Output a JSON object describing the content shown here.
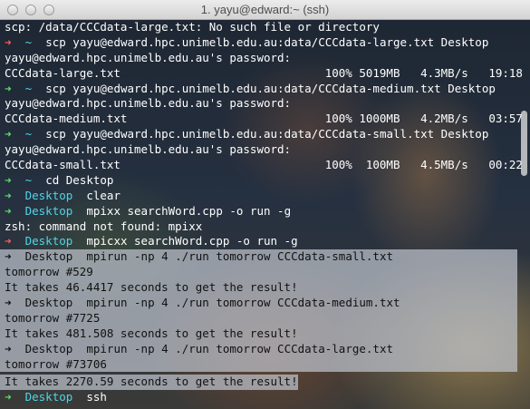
{
  "window": {
    "title": "1. yayu@edward:~ (ssh)"
  },
  "lines": [
    {
      "type": "text",
      "text": "scp: /data/CCCdata-large.txt: No such file or directory"
    },
    {
      "type": "cmd",
      "arrow": "red",
      "dir": "~",
      "cmd": "scp yayu@edward.hpc.unimelb.edu.au:data/CCCdata-large.txt Desktop"
    },
    {
      "type": "text",
      "text": "yayu@edward.hpc.unimelb.edu.au's password:"
    },
    {
      "type": "text",
      "text": "CCCdata-large.txt                              100% 5019MB   4.3MB/s   19:18"
    },
    {
      "type": "cmd",
      "arrow": "green",
      "dir": "~",
      "cmd": "scp yayu@edward.hpc.unimelb.edu.au:data/CCCdata-medium.txt Desktop"
    },
    {
      "type": "text",
      "text": "yayu@edward.hpc.unimelb.edu.au's password:"
    },
    {
      "type": "text",
      "text": "CCCdata-medium.txt                             100% 1000MB   4.2MB/s   03:57"
    },
    {
      "type": "cmd",
      "arrow": "green",
      "dir": "~",
      "cmd": "scp yayu@edward.hpc.unimelb.edu.au:data/CCCdata-small.txt Desktop"
    },
    {
      "type": "text",
      "text": "yayu@edward.hpc.unimelb.edu.au's password:"
    },
    {
      "type": "text",
      "text": "CCCdata-small.txt                              100%  100MB   4.5MB/s   00:22"
    },
    {
      "type": "cmd",
      "arrow": "green",
      "dir": "~",
      "cmd": "cd Desktop"
    },
    {
      "type": "cmd",
      "arrow": "green",
      "dir": "Desktop",
      "cmd": "clear"
    },
    {
      "type": "cmd",
      "arrow": "green",
      "dir": "Desktop",
      "cmd": "mpixx searchWord.cpp -o run -g"
    },
    {
      "type": "text",
      "text": "zsh: command not found: mpixx"
    },
    {
      "type": "cmd",
      "arrow": "red",
      "dir": "Desktop",
      "cmd": "mpicxx searchWord.cpp -o run -g"
    },
    {
      "type": "cmd",
      "arrow": "green",
      "dir": "Desktop",
      "cmd": "mpirun -np 4 ./run tomorrow CCCdata-small.txt",
      "selected": true
    },
    {
      "type": "text",
      "text": "tomorrow #529",
      "selected": true
    },
    {
      "type": "text",
      "text": "It takes 46.4417 seconds to get the result!",
      "selected": true
    },
    {
      "type": "cmd",
      "arrow": "green",
      "dir": "Desktop",
      "cmd": "mpirun -np 4 ./run tomorrow CCCdata-medium.txt",
      "selected": true
    },
    {
      "type": "text",
      "text": "tomorrow #7725",
      "selected": true
    },
    {
      "type": "text",
      "text": "It takes 481.508 seconds to get the result!",
      "selected": true
    },
    {
      "type": "cmd",
      "arrow": "green",
      "dir": "Desktop",
      "cmd": "mpirun -np 4 ./run tomorrow CCCdata-large.txt",
      "selected": true
    },
    {
      "type": "text",
      "text": "tomorrow #73706",
      "selected": true
    },
    {
      "type": "text",
      "text": "It takes 2270.59 seconds to get the result!",
      "selected": true,
      "partial": true
    },
    {
      "type": "cmd",
      "arrow": "green",
      "dir": "Desktop",
      "cmd": "ssh"
    }
  ],
  "prompt_symbol": "➜",
  "colors": {
    "arrow_green": "#5fe06a",
    "arrow_red": "#ff5f5f",
    "dir": "#4fd6e8",
    "selection": "#c0c4cc"
  }
}
